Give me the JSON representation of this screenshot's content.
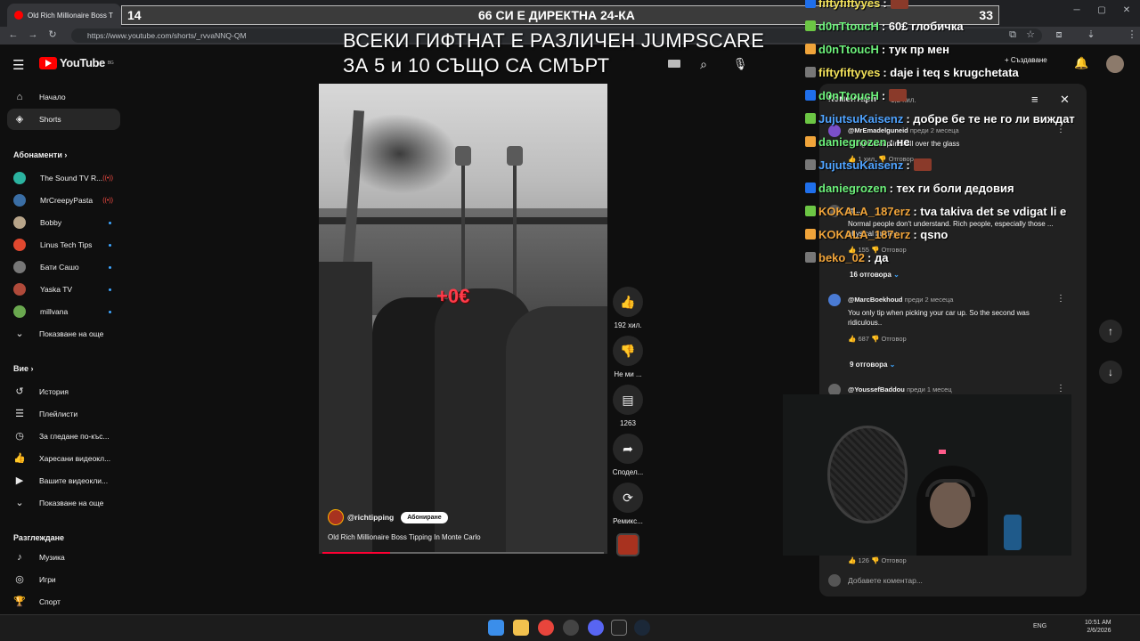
{
  "browser": {
    "tab_title": "Old Rich Millionaire Boss T",
    "url": "https://www.youtube.com/shorts/_rvvaNNQ-QM"
  },
  "overlay": {
    "left_count": "14",
    "banner_text": "66 СИ Е ДИРЕКТНА 24-КА",
    "right_count": "33",
    "alert_line1": "ВСЕКИ ГИФТНАТ Е РАЗЛИЧЕН JUMPSCARE",
    "alert_line2": "ЗА 5 и 10 СЪЩО СА СМЪРТ"
  },
  "header": {
    "logo_text": "YouTube",
    "logo_region": "BG",
    "create_label": "+ Създаване"
  },
  "sidebar": {
    "main": [
      {
        "label": "Начало",
        "icon": "home-icon"
      },
      {
        "label": "Shorts",
        "icon": "shorts-icon"
      }
    ],
    "subs_heading": "Абонаменти",
    "subs": [
      {
        "label": "The Sound TV R...",
        "color": "#2bb3a0",
        "badge": "live"
      },
      {
        "label": "MrCreepyPasta",
        "color": "#3a6ea5",
        "badge": "live"
      },
      {
        "label": "Bobby",
        "color": "#b8a58a",
        "badge": "dot"
      },
      {
        "label": "Linus Tech Tips",
        "color": "#e0482f",
        "badge": "dot"
      },
      {
        "label": "Бати Сашо",
        "color": "#777777",
        "badge": "dot"
      },
      {
        "label": "Yaska TV",
        "color": "#b04a3a",
        "badge": "dot"
      },
      {
        "label": "millvana",
        "color": "#6aa84f",
        "badge": "dot"
      }
    ],
    "show_more": "Показване на още",
    "you_heading": "Вие",
    "you": [
      {
        "label": "История",
        "icon": "history-icon"
      },
      {
        "label": "Плейлисти",
        "icon": "playlists-icon"
      },
      {
        "label": "За гледане по-къс...",
        "icon": "watch-later-icon"
      },
      {
        "label": "Харесани видеокл...",
        "icon": "liked-icon"
      },
      {
        "label": "Вашите видеокли...",
        "icon": "your-videos-icon"
      },
      {
        "label": "Показване на още",
        "icon": "chevron-down-icon"
      }
    ],
    "explore_heading": "Разглеждане",
    "explore": [
      {
        "label": "Музика",
        "icon": "music-icon"
      },
      {
        "label": "Игри",
        "icon": "games-icon"
      },
      {
        "label": "Спорт",
        "icon": "sports-icon"
      }
    ]
  },
  "video": {
    "tip_badge": "+0€",
    "channel": "@richtipping",
    "subscribe": "Абониране",
    "title": "Old Rich Millionaire Boss Tipping In Monte Carlo",
    "progress": 0.24
  },
  "actions": {
    "likes": "192 хил.",
    "dislike": "Не ми ...",
    "comments": "1263",
    "share": "Сподел...",
    "remix": "Ремикс..."
  },
  "comments": {
    "heading": "Коментари",
    "count": "1,2 хил.",
    "items": [
      {
        "channel": "@MrEmadelguneid",
        "when": "преди 2 месеца",
        "text": "...ting theirs prints all over the glass",
        "likes": "1 хил.",
        "color": "#7b4fc9"
      },
      {
        "channel": "@...",
        "when": "",
        "text": "Normal people don't understand. Rich people, especially those ... physical money.",
        "likes": "155",
        "color": "#555555"
      },
      {
        "channel": "@MarcBoekhoud",
        "when": "преди 2 месеца",
        "text": "You only tip when picking your car up. So the second was ridiculous..",
        "likes": "687",
        "color": "#4a7bd4"
      },
      {
        "channel": "@YoussefBaddou",
        "when": "преди 1 месец",
        "text": "",
        "likes": "126",
        "color": "#666666"
      }
    ],
    "replies": [
      "16 отговора",
      "9 отговора"
    ],
    "reply_label": "Отговор",
    "add_placeholder": "Добавете коментар..."
  },
  "chat": [
    {
      "user": "fiftyfiftyyes",
      "text": ":",
      "color": "#f2e15a",
      "emote": true
    },
    {
      "user": "d0nTtoucH",
      "text": ": 60£ глобичка",
      "color": "#6cf07a",
      "emote": false
    },
    {
      "user": "d0nTtoucH",
      "text": ": тук пр мен",
      "color": "#6cf07a",
      "emote": false
    },
    {
      "user": "fiftyfiftyyes",
      "text": ": daje i teq s krugchetata",
      "color": "#f2e15a",
      "emote": false
    },
    {
      "user": "d0nTtoucH",
      "text": ":",
      "color": "#6cf07a",
      "emote": true
    },
    {
      "user": "JujutsuKaisenz",
      "text": ": добре бе те не го ли виждат",
      "color": "#4fa3ff",
      "emote": false
    },
    {
      "user": "daniegrozen",
      "text": ": не",
      "color": "#6cf07a",
      "emote": false
    },
    {
      "user": "JujutsuKaisenz",
      "text": ":",
      "color": "#4fa3ff",
      "emote": true
    },
    {
      "user": "daniegrozen",
      "text": ": тех ги боли дедовия",
      "color": "#6cf07a",
      "emote": false
    },
    {
      "user": "KOKALA_187erz",
      "text": ": tva takiva det se vdigat li e",
      "color": "#f0a43a",
      "emote": false
    },
    {
      "user": "KOKALA_187erz",
      "text": ": qsno",
      "color": "#f0a43a",
      "emote": false
    },
    {
      "user": "beko_02",
      "text": ": да",
      "color": "#f0a43a",
      "emote": false
    }
  ],
  "taskbar": {
    "lang": "ENG",
    "time": "10:51 AM",
    "date": "2/6/2026"
  }
}
